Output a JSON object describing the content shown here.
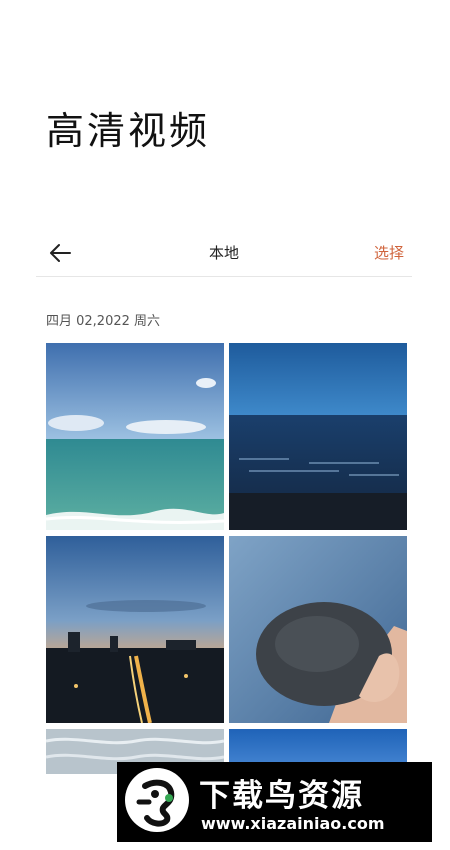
{
  "page_title": "高清视频",
  "navbar": {
    "back_icon": "arrow-left-icon",
    "title": "本地",
    "select_label": "选择"
  },
  "section_date": "四月 02,2022  周六",
  "photos": [
    {
      "subject": "sea with blue sky and waves"
    },
    {
      "subject": "deep blue sea at dusk"
    },
    {
      "subject": "coastal city at sunset"
    },
    {
      "subject": "hand holding dark stone"
    },
    {
      "subject": "sea water surface"
    },
    {
      "subject": "blue sky"
    }
  ],
  "watermark": {
    "brand": "下载鸟资源",
    "url": "www.xiazainiao.com"
  },
  "colors": {
    "accent": "#d0643c"
  }
}
